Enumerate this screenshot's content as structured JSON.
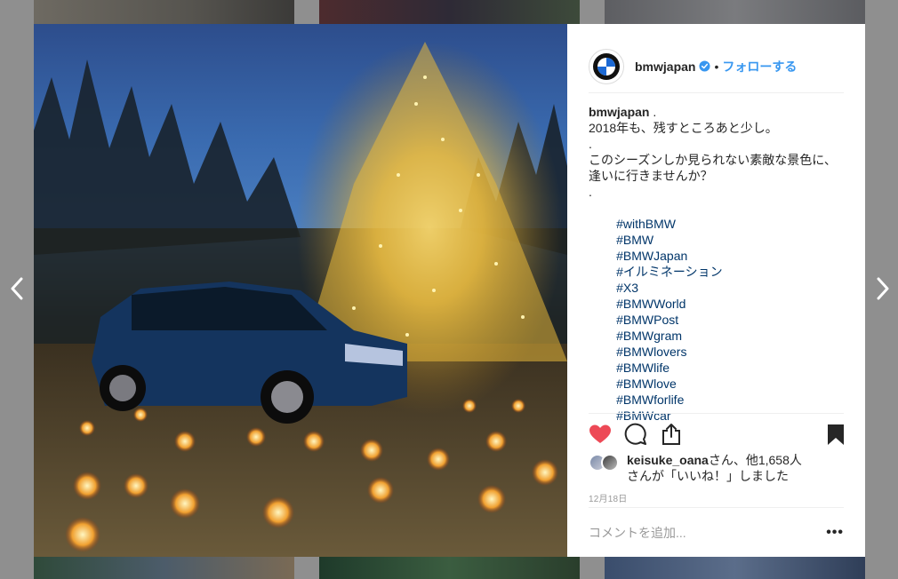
{
  "post": {
    "username": "bmwjapan",
    "verified_icon": "verified-badge-icon",
    "separator": "•",
    "follow_label": "フォローする",
    "caption_user": "bmwjapan",
    "caption_lines": [
      ".",
      "2018年も、残すところあと少し。",
      ".",
      "このシーズンしか見られない素敵な景色に、",
      "逢いに行きませんか？",
      "."
    ],
    "hashtags": [
      "#withBMW",
      "#BMW",
      "#BMWJapan",
      "#イルミネーション",
      "#X3",
      "#BMWWorld",
      "#BMWPost",
      "#BMWgram",
      "#BMWlovers",
      "#BMWlife",
      "#BMWlove",
      "#BMWforlife",
      "#BMWcar"
    ],
    "likes_user": "keisuke_oana",
    "likes_suffix": "さん、他1,658人",
    "likes_line2": "さんが「いいね！」しました",
    "date": "12月18日",
    "comment_placeholder": "コメントを追加...",
    "more_label": "•••"
  },
  "icons": {
    "like": "heart-icon",
    "comment": "comment-icon",
    "share": "share-icon",
    "save": "bookmark-icon",
    "prev": "chevron-left-icon",
    "next": "chevron-right-icon"
  },
  "colors": {
    "like_red": "#ed4956",
    "link_blue": "#3897f0",
    "hashtag_blue": "#003569"
  }
}
